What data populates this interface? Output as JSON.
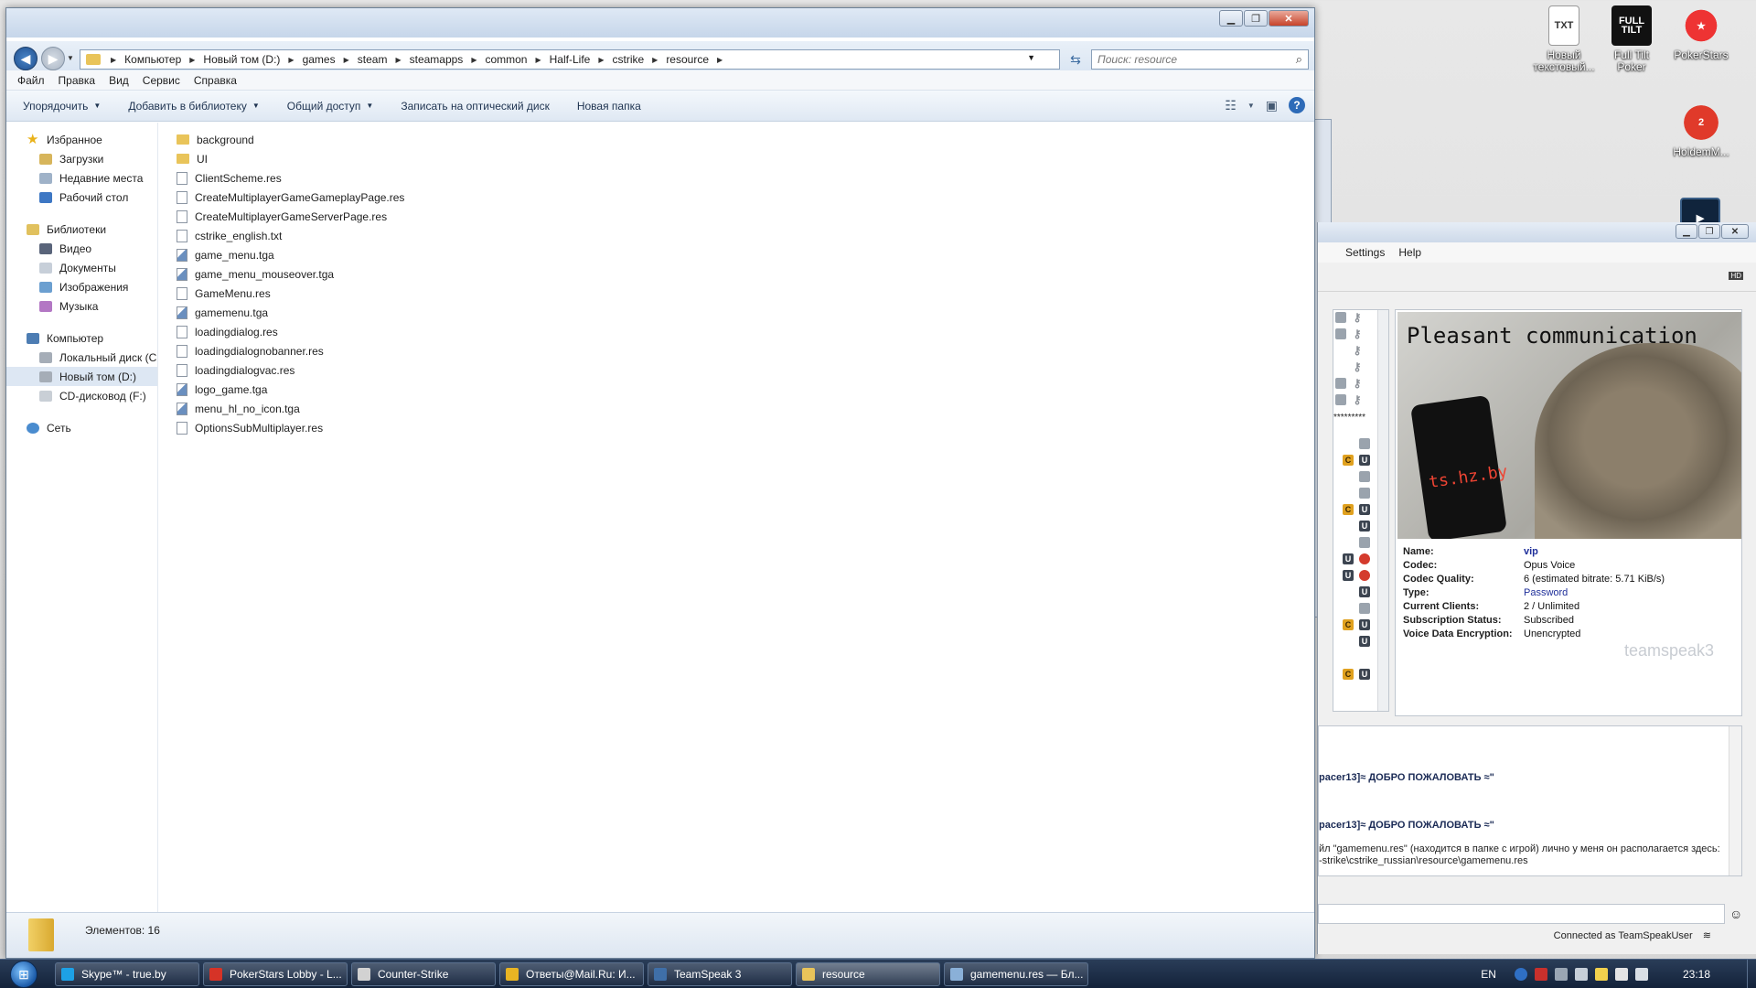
{
  "desktop_icons": [
    {
      "name": "text-document",
      "label": "Новый текстовый...",
      "glyph": "TXT"
    },
    {
      "name": "full-tilt-poker",
      "label": "Full Tilt Poker",
      "glyph": "FULL TILT"
    },
    {
      "name": "pokerstars",
      "label": "PokerStars",
      "glyph": "★"
    },
    {
      "name": "holdem",
      "label": "HoldemM...",
      "glyph": "2"
    }
  ],
  "explorer": {
    "breadcrumb": [
      "Компьютер",
      "Новый том (D:)",
      "games",
      "steam",
      "steamapps",
      "common",
      "Half-Life",
      "cstrike",
      "resource"
    ],
    "search_placeholder": "Поиск: resource",
    "menu": [
      "Файл",
      "Правка",
      "Вид",
      "Сервис",
      "Справка"
    ],
    "toolbar": [
      "Упорядочить",
      "Добавить в библиотеку",
      "Общий доступ",
      "Записать на оптический диск",
      "Новая папка"
    ],
    "nav": {
      "favorites_label": "Избранное",
      "favorites": [
        "Загрузки",
        "Недавние места",
        "Рабочий стол"
      ],
      "libraries_label": "Библиотеки",
      "libraries": [
        "Видео",
        "Документы",
        "Изображения",
        "Музыка"
      ],
      "computer_label": "Компьютер",
      "computer": [
        "Локальный диск (C:)",
        "Новый том (D:)",
        "CD-дисковод (F:)"
      ],
      "network_label": "Сеть"
    },
    "files": [
      {
        "name": "background",
        "type": "folder"
      },
      {
        "name": "UI",
        "type": "folder"
      },
      {
        "name": "ClientScheme.res",
        "type": "file"
      },
      {
        "name": "CreateMultiplayerGameGameplayPage.res",
        "type": "file"
      },
      {
        "name": "CreateMultiplayerGameServerPage.res",
        "type": "file"
      },
      {
        "name": "cstrike_english.txt",
        "type": "file"
      },
      {
        "name": "game_menu.tga",
        "type": "image"
      },
      {
        "name": "game_menu_mouseover.tga",
        "type": "image"
      },
      {
        "name": "GameMenu.res",
        "type": "file"
      },
      {
        "name": "gamemenu.tga",
        "type": "image"
      },
      {
        "name": "loadingdialog.res",
        "type": "file"
      },
      {
        "name": "loadingdialognobanner.res",
        "type": "file"
      },
      {
        "name": "loadingdialogvac.res",
        "type": "file"
      },
      {
        "name": "logo_game.tga",
        "type": "image"
      },
      {
        "name": "menu_hl_no_icon.tga",
        "type": "image"
      },
      {
        "name": "OptionsSubMultiplayer.res",
        "type": "file"
      }
    ],
    "status": "Элементов: 16"
  },
  "teamspeak": {
    "menu": [
      "Settings",
      "Help"
    ],
    "banner_text": "Pleasant communication",
    "banner_phone_text": "ts.hz.by",
    "stars": "*********",
    "properties": [
      {
        "key": "Name:",
        "value": "vip",
        "style": "link bold"
      },
      {
        "key": "Codec:",
        "value": "Opus Voice",
        "style": ""
      },
      {
        "key": "Codec Quality:",
        "value": "6 (estimated bitrate: 5.71 KiB/s)",
        "style": ""
      },
      {
        "key": "Type:",
        "value": "Password",
        "style": "link"
      },
      {
        "key": "Current Clients:",
        "value": "2 / Unlimited",
        "style": ""
      },
      {
        "key": "Subscription Status:",
        "value": "Subscribed",
        "style": ""
      },
      {
        "key": "Voice Data Encryption:",
        "value": "Unencrypted",
        "style": ""
      }
    ],
    "logo": "teamspeak3",
    "chat": [
      {
        "text": "pacer13]≈ ДОБРО ПОЖАЛОВАТЬ ≈\"",
        "bold": true
      },
      {
        "text": "pacer13]≈ ДОБРО ПОЖАЛОВАТЬ ≈\"",
        "bold": true
      },
      {
        "text": "йл \"gamemenu.res\" (находится в папке с игрой) лично у меня он располагается здесь:",
        "bold": false
      },
      {
        "text": "-strike\\cstrike_russian\\resource\\gamemenu.res",
        "bold": false
      }
    ],
    "status": "Connected as TeamSpeakUser"
  },
  "taskbar": {
    "tasks": [
      {
        "label": "Skype™ - true.by",
        "color": "#1da1e6"
      },
      {
        "label": "PokerStars Lobby - L...",
        "color": "#d63327"
      },
      {
        "label": "Counter-Strike",
        "color": "#d2d2d2"
      },
      {
        "label": "Ответы@Mail.Ru: И...",
        "color": "#e8b423"
      },
      {
        "label": "TeamSpeak 3",
        "color": "#3f6fa8"
      },
      {
        "label": "resource",
        "color": "#e9c45a"
      },
      {
        "label": "gamemenu.res — Бл...",
        "color": "#8ab0d8"
      }
    ],
    "lang": "EN",
    "clock": "23:18"
  }
}
